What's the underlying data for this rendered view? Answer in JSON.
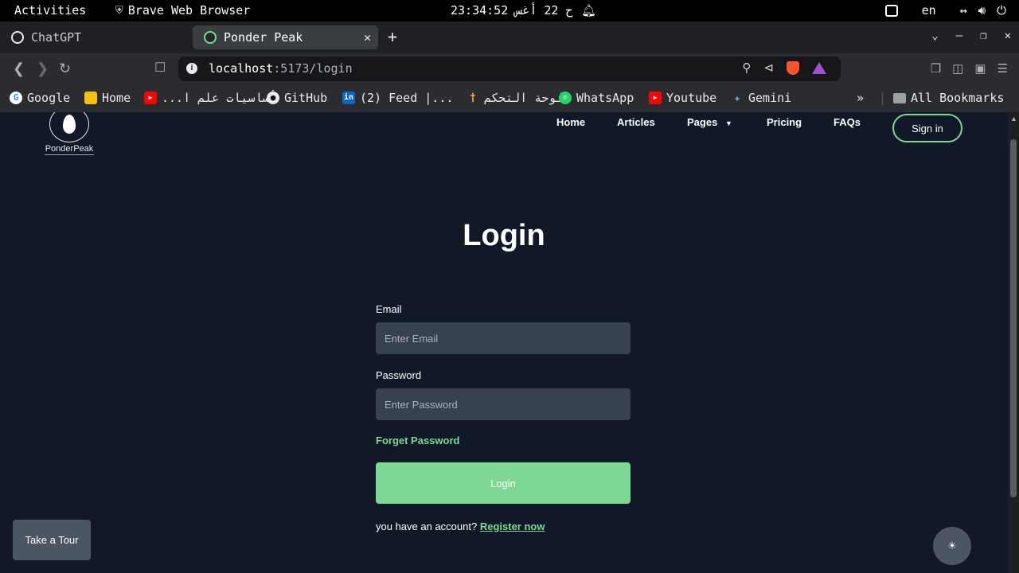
{
  "system_bar": {
    "activities": "Activities",
    "app_name": "Brave Web Browser",
    "clock": "ح 22 أغس 23:34:52",
    "lang": "en"
  },
  "tabs": [
    {
      "label": "ChatGPT",
      "active": false
    },
    {
      "label": "Ponder Peak",
      "active": true
    }
  ],
  "address": {
    "host": "localhost",
    "path": ":5173/login"
  },
  "bookmarks": [
    {
      "label": "Google",
      "icon": "google-icon"
    },
    {
      "label": "Home",
      "icon": "home-icon"
    },
    {
      "label": "أساسيات علم ا...",
      "icon": "youtube-icon"
    },
    {
      "label": "GitHub",
      "icon": "github-icon"
    },
    {
      "label": "(2) Feed |...",
      "icon": "linkedin-icon"
    },
    {
      "label": "لوحة التحكم",
      "icon": "torch-icon"
    },
    {
      "label": "WhatsApp",
      "icon": "whatsapp-icon"
    },
    {
      "label": "Youtube",
      "icon": "youtube-icon"
    },
    {
      "label": "Gemini",
      "icon": "gemini-icon"
    },
    {
      "label": "All Bookmarks",
      "icon": "folder-icon"
    }
  ],
  "site": {
    "logo_text": "PonderPeak",
    "nav": {
      "home": "Home",
      "articles": "Articles",
      "pages": "Pages",
      "pricing": "Pricing",
      "faqs": "FAQs",
      "signin": "Sign in"
    },
    "title": "Login",
    "form": {
      "email_label": "Email",
      "email_placeholder": "Enter Email",
      "password_label": "Password",
      "password_placeholder": "Enter Password",
      "forgot": "Forget Password",
      "submit": "Login",
      "register_prompt": "you have an account?",
      "register_link": "Register now"
    },
    "tour": "Take a Tour"
  },
  "colors": {
    "accent": "#7dd893",
    "background": "#111827",
    "input_bg": "#374151"
  }
}
